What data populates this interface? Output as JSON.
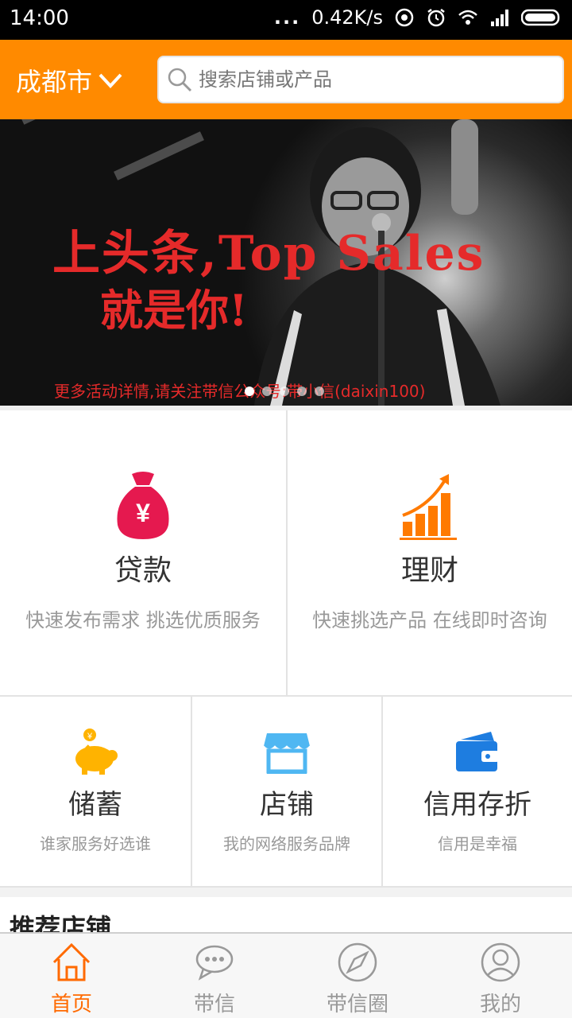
{
  "status_bar": {
    "time": "14:00",
    "dots": "...",
    "network_speed": "0.42K/s"
  },
  "header": {
    "city": "成都市",
    "search_placeholder": "搜索店铺或产品"
  },
  "banner": {
    "headline": "上头条,Top Sales",
    "headline2": "就是你!",
    "footer_text": "更多活动详情,请关注带信公众号:带小信(daixin100)",
    "page_count": 5,
    "active_index": 0
  },
  "features_large": [
    {
      "title": "贷款",
      "desc": "快速发布需求 挑选优质服务",
      "icon": "money-bag-icon"
    },
    {
      "title": "理财",
      "desc": "快速挑选产品 在线即时咨询",
      "icon": "growth-chart-icon"
    }
  ],
  "features_small": [
    {
      "title": "储蓄",
      "desc": "谁家服务好选谁",
      "icon": "piggy-bank-icon"
    },
    {
      "title": "店铺",
      "desc": "我的网络服务品牌",
      "icon": "store-icon"
    },
    {
      "title": "信用存折",
      "desc": "信用是幸福",
      "icon": "wallet-icon"
    }
  ],
  "section": {
    "title": "推荐店铺"
  },
  "tabs": [
    {
      "label": "首页",
      "icon": "home-icon",
      "active": true
    },
    {
      "label": "带信",
      "icon": "chat-icon",
      "active": false
    },
    {
      "label": "带信圈",
      "icon": "compass-icon",
      "active": false
    },
    {
      "label": "我的",
      "icon": "user-icon",
      "active": false
    }
  ],
  "colors": {
    "brand": "#ff8a00",
    "tab_active": "#ff6a00",
    "loan": "#e5194f",
    "finance": "#ff7a00",
    "savings": "#ffb300",
    "store": "#4fb7f2",
    "credit": "#1e7de0"
  }
}
